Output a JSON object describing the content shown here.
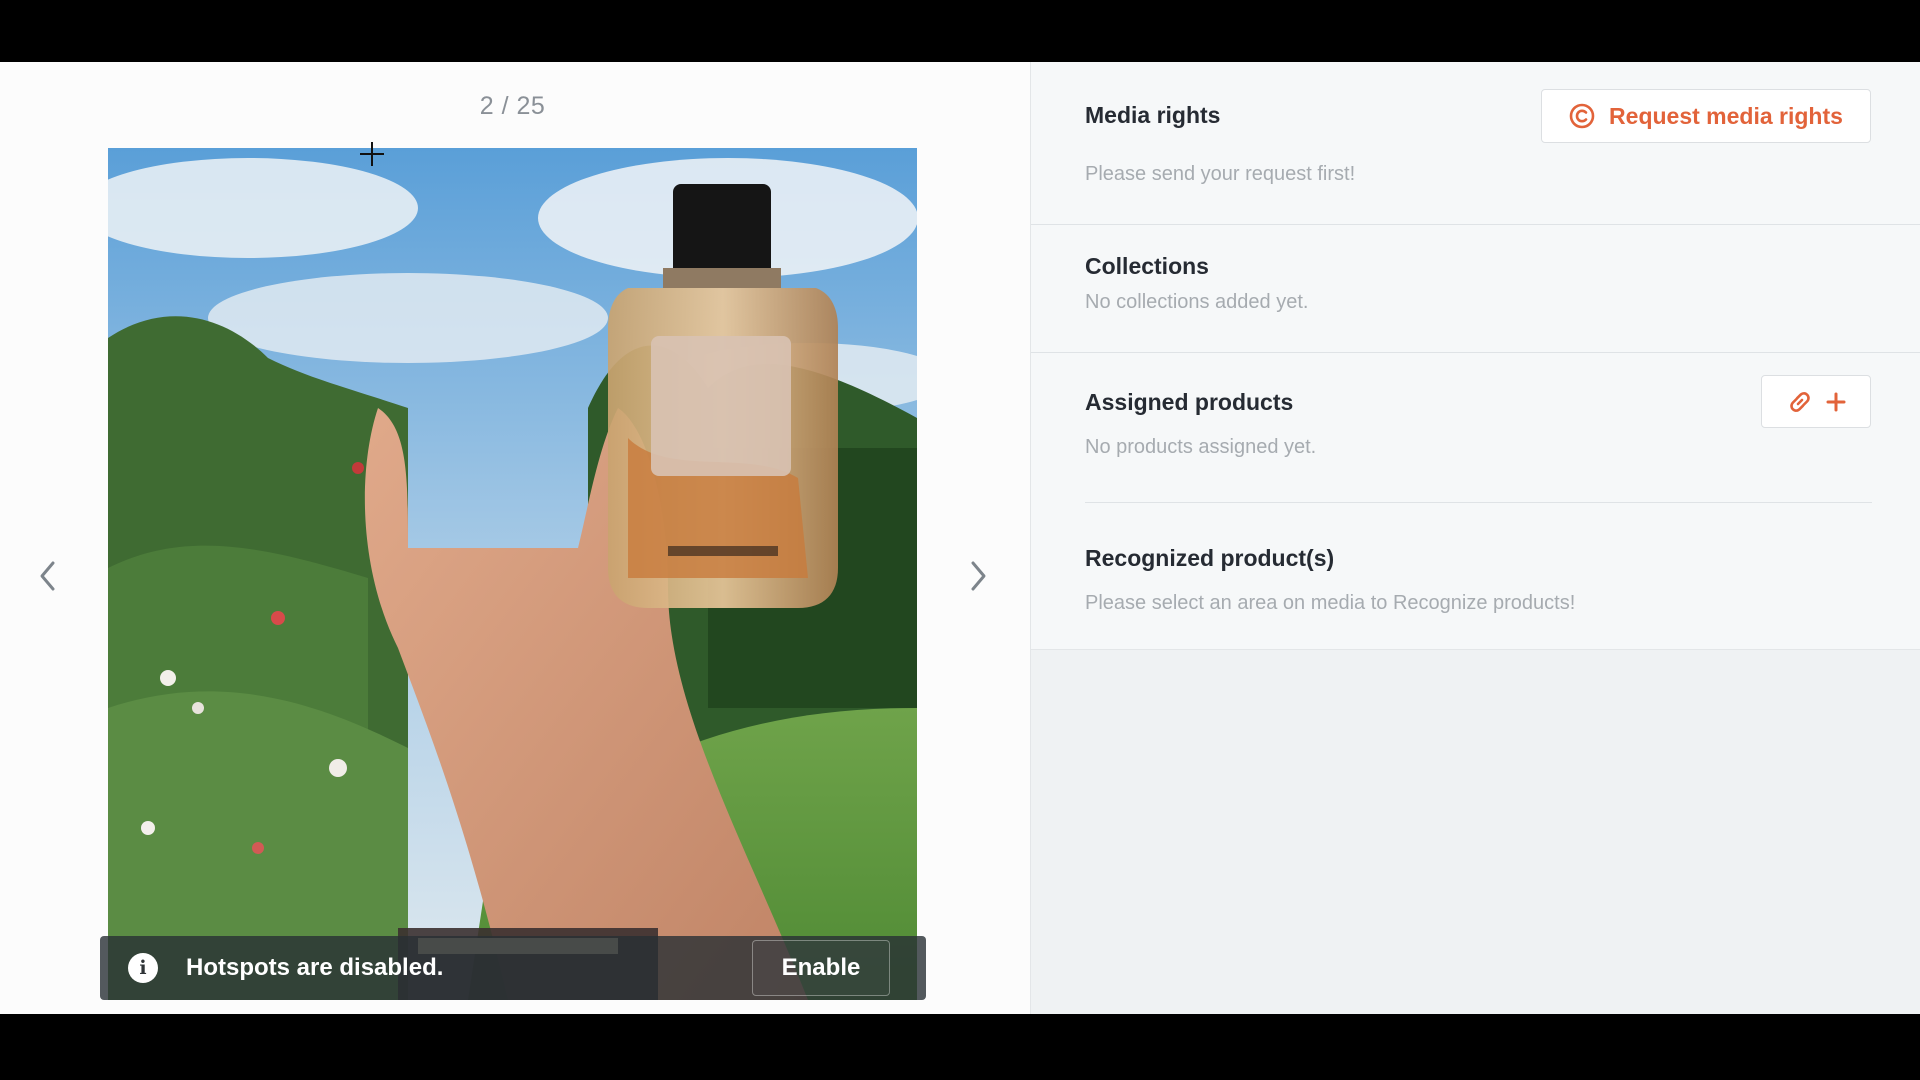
{
  "viewer": {
    "counter": "2 / 25",
    "hotspots_message": "Hotspots are disabled.",
    "enable_label": "Enable"
  },
  "media_rights": {
    "title": "Media rights",
    "request_label": "Request media rights",
    "subtitle": "Please send your request first!"
  },
  "collections": {
    "title": "Collections",
    "subtitle": "No collections added yet."
  },
  "assigned_products": {
    "title": "Assigned products",
    "subtitle": "No products assigned yet."
  },
  "recognized_products": {
    "title": "Recognized product(s)",
    "subtitle": "Please select an area on media to Recognize products!"
  },
  "colors": {
    "accent": "#e2633a",
    "heading": "#262b33",
    "muted": "#a6abb0"
  },
  "icons": {
    "prev": "chevron-left-icon",
    "next": "chevron-right-icon",
    "info": "info-icon",
    "copyright": "copyright-icon",
    "link": "link-icon",
    "plus": "plus-icon"
  }
}
